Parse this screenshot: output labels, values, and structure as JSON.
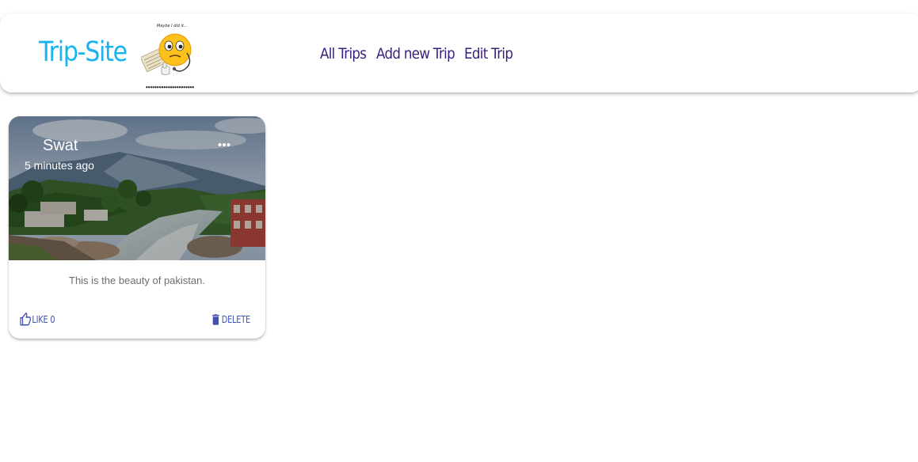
{
  "header": {
    "brand": "Trip-Site",
    "logo_caption": "Maybe I did it...",
    "nav": [
      {
        "label": "All Trips"
      },
      {
        "label": "Add new Trip"
      },
      {
        "label": "Edit Trip"
      }
    ]
  },
  "post": {
    "title": "Swat",
    "time": "5 minutes ago",
    "description": "This is the beauty of pakistan.",
    "like_label": "LIKE 0",
    "delete_label": "DELETE"
  },
  "colors": {
    "brand": "#1ab3ef",
    "nav": "#3a1e7e",
    "action": "#3f51b5"
  },
  "icons": {
    "logo": "emoji-thinking-icon",
    "more": "more-horiz-icon",
    "like": "thumb-up-icon",
    "delete": "trash-icon"
  }
}
